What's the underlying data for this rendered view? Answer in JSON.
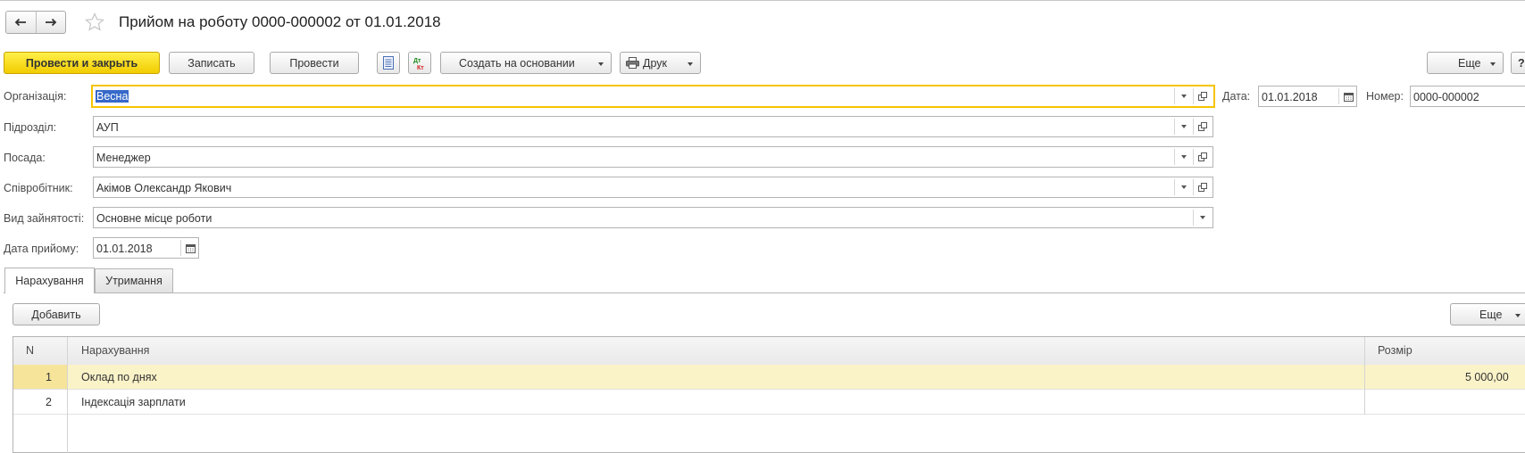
{
  "window": {
    "title": "Прийом на роботу 0000-000002 от 01.01.2018"
  },
  "nav": {
    "back_icon": "arrow-left-icon",
    "forward_icon": "arrow-right-icon",
    "favorite_icon": "star-icon"
  },
  "toolbar": {
    "post_close": "Провести и закрыть",
    "save": "Записать",
    "post": "Провести",
    "create_based": "Создать на основании",
    "print": "Друк",
    "more": "Еще",
    "help": "?"
  },
  "form": {
    "organization": {
      "label": "Організація:",
      "value": "Весна"
    },
    "date": {
      "label": "Дата:",
      "value": "01.01.2018"
    },
    "number": {
      "label": "Номер:",
      "value": "0000-000002"
    },
    "department": {
      "label": "Підрозділ:",
      "value": "АУП"
    },
    "position": {
      "label": "Посада:",
      "value": "Менеджер"
    },
    "employee": {
      "label": "Співробітник:",
      "value": "Акімов Олександр Якович"
    },
    "employment_type": {
      "label": "Вид зайнятості:",
      "value": "Основне місце роботи"
    },
    "hire_date": {
      "label": "Дата прийому:",
      "value": "01.01.2018"
    }
  },
  "tabs": [
    {
      "label": "Нарахування",
      "active": true
    },
    {
      "label": "Утримання",
      "active": false
    }
  ],
  "table_toolbar": {
    "add": "Добавить",
    "more": "Еще"
  },
  "table": {
    "columns": [
      "N",
      "Нарахування",
      "Розмір"
    ],
    "rows": [
      {
        "n": "1",
        "accrual": "Оклад по днях",
        "amount": "5 000,00",
        "selected": true
      },
      {
        "n": "2",
        "accrual": "Індексація зарплати",
        "amount": "",
        "selected": false
      }
    ]
  },
  "colors": {
    "primary_button": "#f2cc00",
    "focus_border": "#f5c400",
    "selected_row": "#fbf3c8"
  }
}
